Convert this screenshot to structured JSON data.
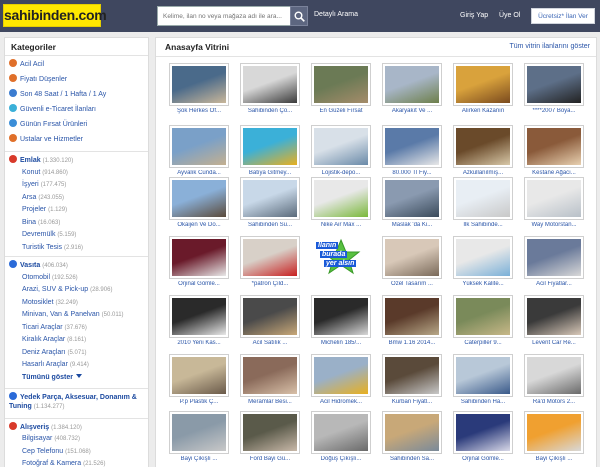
{
  "header": {
    "logo_text": "sahibinden.com",
    "search_placeholder": "Kelime, ilan no veya mağaza adı ile ara...",
    "advanced_search": "Detaylı Arama",
    "login": "Giriş Yap",
    "signup": "Üye Ol",
    "free_ad_button": "Ücretsiz* İlan Ver"
  },
  "sidebar": {
    "title": "Kategoriler",
    "quick_links": [
      {
        "label": "Acil Acil",
        "icon": "urgent-icon",
        "color": "#e0702a"
      },
      {
        "label": "Fiyatı Düşenler",
        "icon": "price-drop-icon",
        "color": "#e0702a"
      },
      {
        "label": "Son 48 Saat / 1 Hafta / 1 Ay",
        "icon": "clock-icon",
        "color": "#3b7cd0"
      },
      {
        "label": "Güvenli e-Ticaret İlanları",
        "icon": "secure-shop-icon",
        "color": "#3bb0d8"
      },
      {
        "label": "Günün Fırsat Ürünleri",
        "icon": "deal-icon",
        "color": "#3b8ed8"
      },
      {
        "label": "Ustalar ve Hizmetler",
        "icon": "tools-icon",
        "color": "#e0702a"
      }
    ],
    "categories": [
      {
        "name": "Emlak",
        "count": "(1.330.120)",
        "icon": "home-icon",
        "color": "#d83a2a",
        "subs": [
          {
            "label": "Konut",
            "count": "(914.860)"
          },
          {
            "label": "İşyeri",
            "count": "(177.475)"
          },
          {
            "label": "Arsa",
            "count": "(243.055)"
          },
          {
            "label": "Projeler",
            "count": "(1.129)"
          },
          {
            "label": "Bina",
            "count": "(16.063)"
          },
          {
            "label": "Devremülk",
            "count": "(5.159)"
          },
          {
            "label": "Turistik Tesis",
            "count": "(2.916)"
          }
        ]
      },
      {
        "name": "Vasıta",
        "count": "(406.034)",
        "icon": "car-icon",
        "color": "#2a6ad8",
        "subs": [
          {
            "label": "Otomobil",
            "count": "(192.526)"
          },
          {
            "label": "Arazi, SUV & Pick-up",
            "count": "(28.906)"
          },
          {
            "label": "Motosiklet",
            "count": "(32.249)"
          },
          {
            "label": "Minivan, Van & Panelvan",
            "count": "(50.011)"
          },
          {
            "label": "Ticari Araçlar",
            "count": "(37.676)"
          },
          {
            "label": "Kiralık Araçlar",
            "count": "(8.161)"
          },
          {
            "label": "Deniz Araçları",
            "count": "(5.071)"
          },
          {
            "label": "Hasarlı Araçlar",
            "count": "(9.414)"
          }
        ],
        "more": "Tümünü göster"
      },
      {
        "name": "Yedek Parça, Aksesuar, Donanım & Tuning",
        "count": "(1.134.277)",
        "icon": "gear-icon",
        "color": "#2a6ad8",
        "subs": []
      },
      {
        "name": "Alışveriş",
        "count": "(1.384.120)",
        "icon": "shopping-icon",
        "color": "#d83a2a",
        "subs": [
          {
            "label": "Bilgisayar",
            "count": "(408.732)"
          },
          {
            "label": "Cep Telefonu",
            "count": "(151.068)"
          },
          {
            "label": "Fotoğraf & Kamera",
            "count": "(21.526)"
          }
        ]
      }
    ]
  },
  "main": {
    "title": "Anasayfa Vitrini",
    "all_link": "Tüm vitrin ilanlarını göster",
    "listings": [
      "Şok Herkes Of...",
      "Sahibinden Ço...",
      "En Güzeli Fırsat",
      "Akaryakıt Ve ...",
      "Alırken Kazanın",
      "****2007 Boya...",
      "Ayvalık Cunda...",
      "Batıya Gitmey...",
      "Lojistik-depo...",
      "80.000 Tl Fiy...",
      "Azkullanılmış...",
      "Kestane Ağacı...",
      "Okaijen Ve Do...",
      "Sahibinden Su...",
      "Nike Air Max ...",
      "Maslak 'da Ki...",
      "İlk Sahibinde...",
      "Way Motorstan...",
      "Orjinal Gömle...",
      "*patron Çıld...",
      "",
      "Özel Tasarım ...",
      "Yüksek Kalite...",
      "Acil Fiyatlar...",
      "2010 Yeni Kas...",
      "Acil Satılık ...",
      "Michelin 185/...",
      "Bmw 1.16 2014...",
      "Caterpiller 9...",
      "Levent Car Re...",
      "P.p Plastik Ç...",
      "Meramlar Besi...",
      "Acil Hidromek...",
      "Kurban Fiyatl...",
      "Sahibinden Ha...",
      "Ra'd Motors 2...",
      "Bayi Çıkışlı ...",
      "Ford Bayi Gü...",
      "Doğuş Çıkışlı...",
      "Sahibinden Sa...",
      "Orjinal Gömle...",
      "Bayi Çıkışlı ..."
    ],
    "promo_text_line1": "İlanın",
    "promo_text_line2": "burada",
    "promo_text_line3": "yer alsın"
  },
  "colors": {
    "header_bg": "#3f475f",
    "logo_bg": "#ffe800",
    "link": "#2a55a8"
  }
}
